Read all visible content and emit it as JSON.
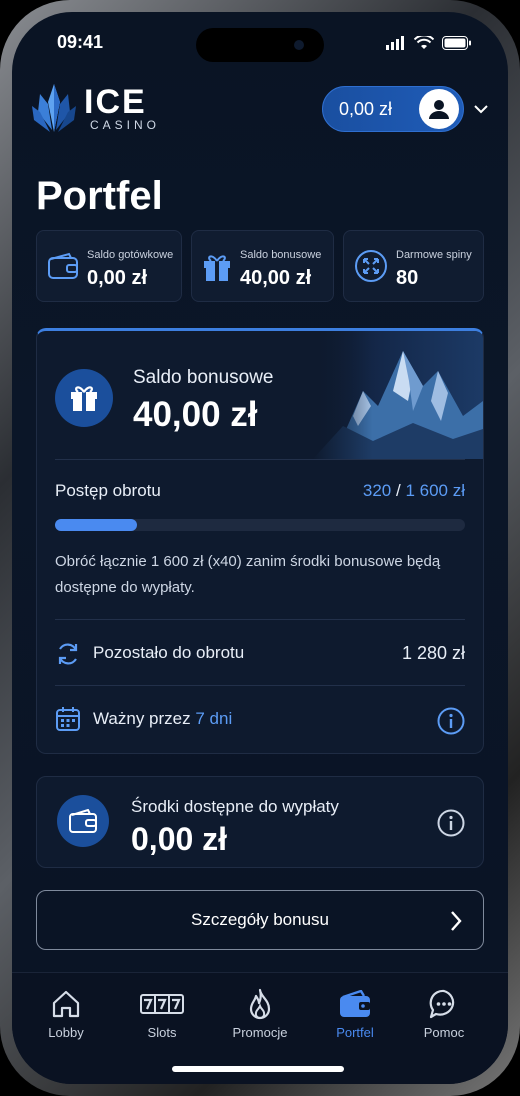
{
  "status_bar": {
    "time": "09:41"
  },
  "header": {
    "logo_main": "ICE",
    "logo_sub": "CASINO",
    "balance": "0,00 zł"
  },
  "page_title": "Portfel",
  "stats": [
    {
      "label": "Saldo gotówkowe",
      "value": "0,00 zł",
      "icon": "wallet-icon"
    },
    {
      "label": "Saldo bonusowe",
      "value": "40,00 zł",
      "icon": "gift-icon"
    },
    {
      "label": "Darmowe spiny",
      "value": "80",
      "icon": "spin-icon"
    }
  ],
  "bonus": {
    "label": "Saldo bonusowe",
    "value": "40,00 zł",
    "progress_label": "Postęp obrotu",
    "progress_current": "320",
    "progress_separator": "/",
    "progress_total": "1 600 zł",
    "progress_fraction": 0.2,
    "description": "Obróć łącznie 1 600 zł (x40) zanim środki bonusowe będą dostępne do wypłaty.",
    "remaining_label": "Pozostało do obrotu",
    "remaining_value": "1 280 zł",
    "valid_label": "Ważny przez",
    "valid_value": "7 dni"
  },
  "withdraw": {
    "label": "Środki dostępne do wypłaty",
    "value": "0,00 zł"
  },
  "details_button": "Szczegóły bonusu",
  "nav": [
    {
      "label": "Lobby",
      "icon": "home-icon"
    },
    {
      "label": "Slots",
      "icon": "slots-icon"
    },
    {
      "label": "Promocje",
      "icon": "flame-icon"
    },
    {
      "label": "Portfel",
      "icon": "wallet-icon",
      "active": true
    },
    {
      "label": "Pomoc",
      "icon": "chat-icon"
    }
  ],
  "colors": {
    "accent": "#4a8af0",
    "background": "#0a1424",
    "card": "#0e1a2e"
  }
}
